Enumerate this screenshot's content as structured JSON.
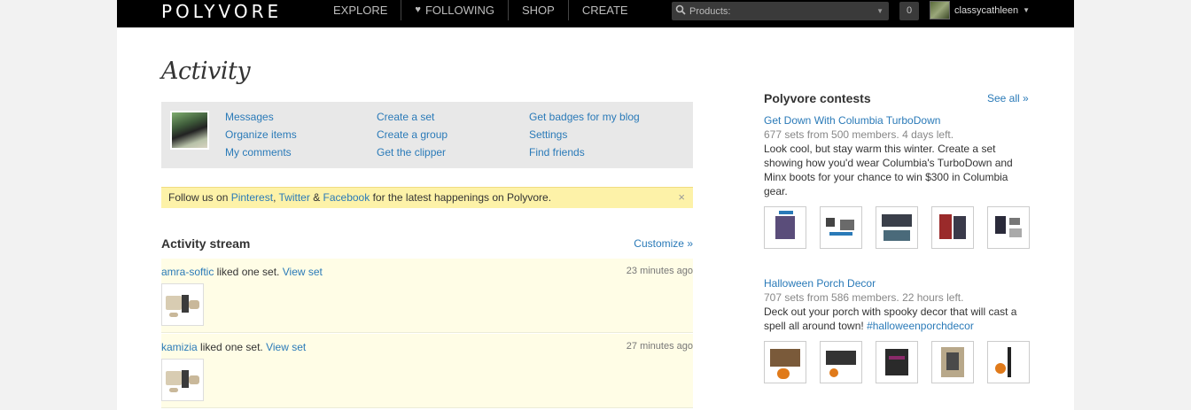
{
  "topbar": {
    "logo": "POLYVORE",
    "nav": [
      "EXPLORE",
      "FOLLOWING",
      "SHOP",
      "CREATE"
    ],
    "search_select": "Products:",
    "notifications": "0",
    "username": "classycathleen",
    "icons": [
      "search-icon",
      "heart-icon",
      "caret-down-icon"
    ]
  },
  "page": {
    "title": "Activity",
    "quick_links": {
      "col1": [
        "Messages",
        "Organize items",
        "My comments"
      ],
      "col2": [
        "Create a set",
        "Create a group",
        "Get the clipper"
      ],
      "col3": [
        "Get badges for my blog",
        "Settings",
        "Find friends"
      ]
    },
    "follow": {
      "prefix": "Follow us on ",
      "pinterest": "Pinterest",
      "comma": ", ",
      "twitter": "Twitter",
      "amp": " & ",
      "facebook": "Facebook",
      "suffix": " for the latest happenings on Polyvore.",
      "close": "×"
    },
    "stream": {
      "heading": "Activity stream",
      "customize": "Customize »",
      "items": [
        {
          "user": "amra-softic",
          "action": " liked one set. ",
          "link": "View set",
          "time": "23 minutes ago"
        },
        {
          "user": "kamizia",
          "action": " liked one set. ",
          "link": "View set",
          "time": "27 minutes ago"
        }
      ]
    }
  },
  "sidebar": {
    "heading": "Polyvore contests",
    "see_all": "See all »",
    "contests": [
      {
        "title": "Get Down With Columbia TurboDown",
        "meta": "677 sets from 500 members. 4 days left.",
        "desc": "Look cool, but stay warm this winter. Create a set showing how you'd wear Columbia's TurboDown and Minx boots for your chance to win $300 in Columbia gear."
      },
      {
        "title": "Halloween Porch Decor",
        "meta": "707 sets from 586 members. 22 hours left.",
        "desc": "Deck out your porch with spooky decor that will cast a spell all around town! ",
        "hashtag": "#halloweenporchdecor"
      }
    ]
  }
}
